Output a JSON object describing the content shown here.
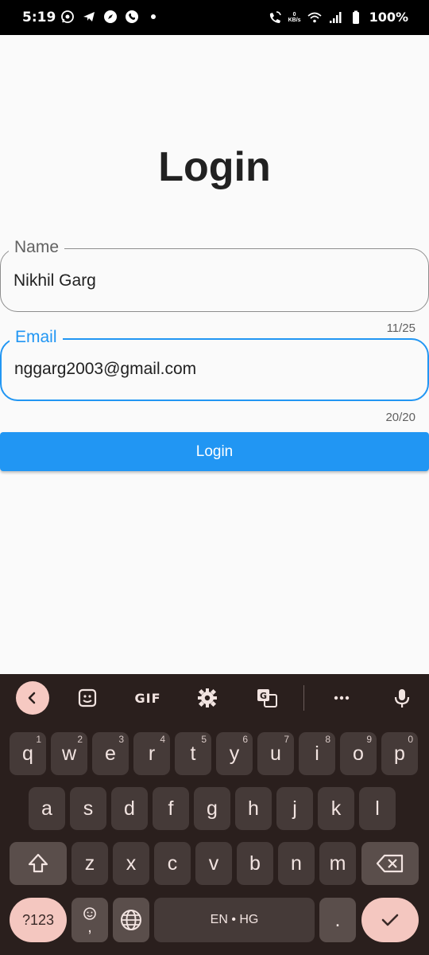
{
  "status_bar": {
    "time": "5:19",
    "left_icons": [
      "whatsapp-icon",
      "telegram-icon",
      "compass-icon",
      "phone-icon",
      "dot-icon"
    ],
    "net_speed_value": "0",
    "net_speed_unit": "KB/s",
    "battery": "100%"
  },
  "app": {
    "title": "Login",
    "name_field": {
      "label": "Name",
      "value": "Nikhil Garg",
      "counter": "11/25"
    },
    "email_field": {
      "label": "Email",
      "value": "nggarg2003@gmail.com",
      "counter": "20/20"
    },
    "login_button": "Login",
    "accent_color": "#2196f3"
  },
  "keyboard": {
    "toolbar": [
      "back-icon",
      "sticker-icon",
      "GIF",
      "settings-icon",
      "translate-icon",
      "more-icon",
      "mic-icon"
    ],
    "gif_label": "GIF",
    "row1": [
      {
        "k": "q",
        "h": "1"
      },
      {
        "k": "w",
        "h": "2"
      },
      {
        "k": "e",
        "h": "3"
      },
      {
        "k": "r",
        "h": "4"
      },
      {
        "k": "t",
        "h": "5"
      },
      {
        "k": "y",
        "h": "6"
      },
      {
        "k": "u",
        "h": "7"
      },
      {
        "k": "i",
        "h": "8"
      },
      {
        "k": "o",
        "h": "9"
      },
      {
        "k": "p",
        "h": "0"
      }
    ],
    "row2": [
      "a",
      "s",
      "d",
      "f",
      "g",
      "h",
      "j",
      "k",
      "l"
    ],
    "row3": [
      "z",
      "x",
      "c",
      "v",
      "b",
      "n",
      "m"
    ],
    "sym_label": "?123",
    "comma_label": ",",
    "space_label": "EN • HG",
    "period_label": "."
  }
}
